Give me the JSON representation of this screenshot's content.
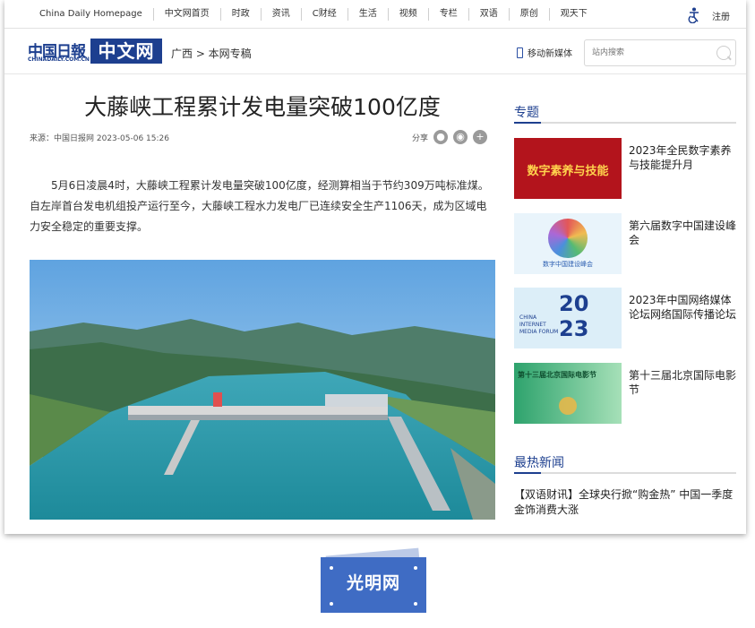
{
  "topnav": {
    "items": [
      "China Daily Homepage",
      "中文网首页",
      "时政",
      "资讯",
      "C财经",
      "生活",
      "视频",
      "专栏",
      "双语",
      "原创",
      "观天下"
    ],
    "register": "注册",
    "accessibility_icon": "accessibility-icon"
  },
  "header": {
    "logo_cn": "中国日報",
    "logo_url": "CHINADAILY.COM.CN",
    "logo_zw": "中文网",
    "breadcrumb": "广西 > 本网专稿",
    "mobile": "移动新媒体",
    "search_placeholder": "站内搜索"
  },
  "article": {
    "title": "大藤峡工程累计发电量突破100亿度",
    "meta": "来源：中国日报网  2023-05-06 15:26",
    "share_label": "分享",
    "body": "5月6日凌晨4时，大藤峡工程累计发电量突破100亿度，经测算相当于节约309万吨标准煤。自左岸首台发电机组投产运行至今，大藤峡工程水力发电厂已连续安全生产1106天，成为区域电力安全稳定的重要支撑。"
  },
  "sidebar": {
    "topics_title": "专题",
    "topics": [
      {
        "text": "2023年全民数字素养与技能提升月",
        "thumb_text": "数字素养与技能"
      },
      {
        "text": "第六届数字中国建设峰会",
        "thumb_text": "数字中国建设峰会"
      },
      {
        "text": "2023年中国网络媒体论坛网络国际传播论坛",
        "thumb_text": "CHINA INTERNET MEDIA FORUM"
      },
      {
        "text": "第十三届北京国际电影节",
        "thumb_text": "第十三届北京国际电影节"
      }
    ],
    "hot_title": "最热新闻",
    "hot_items": [
      "【双语财讯】全球央行掀“购金热” 中国一季度金饰消费大涨"
    ]
  },
  "watermark": {
    "text": "光明网"
  },
  "colors": {
    "brand": "#1d3f8f",
    "watermark": "#3f6cc4"
  }
}
